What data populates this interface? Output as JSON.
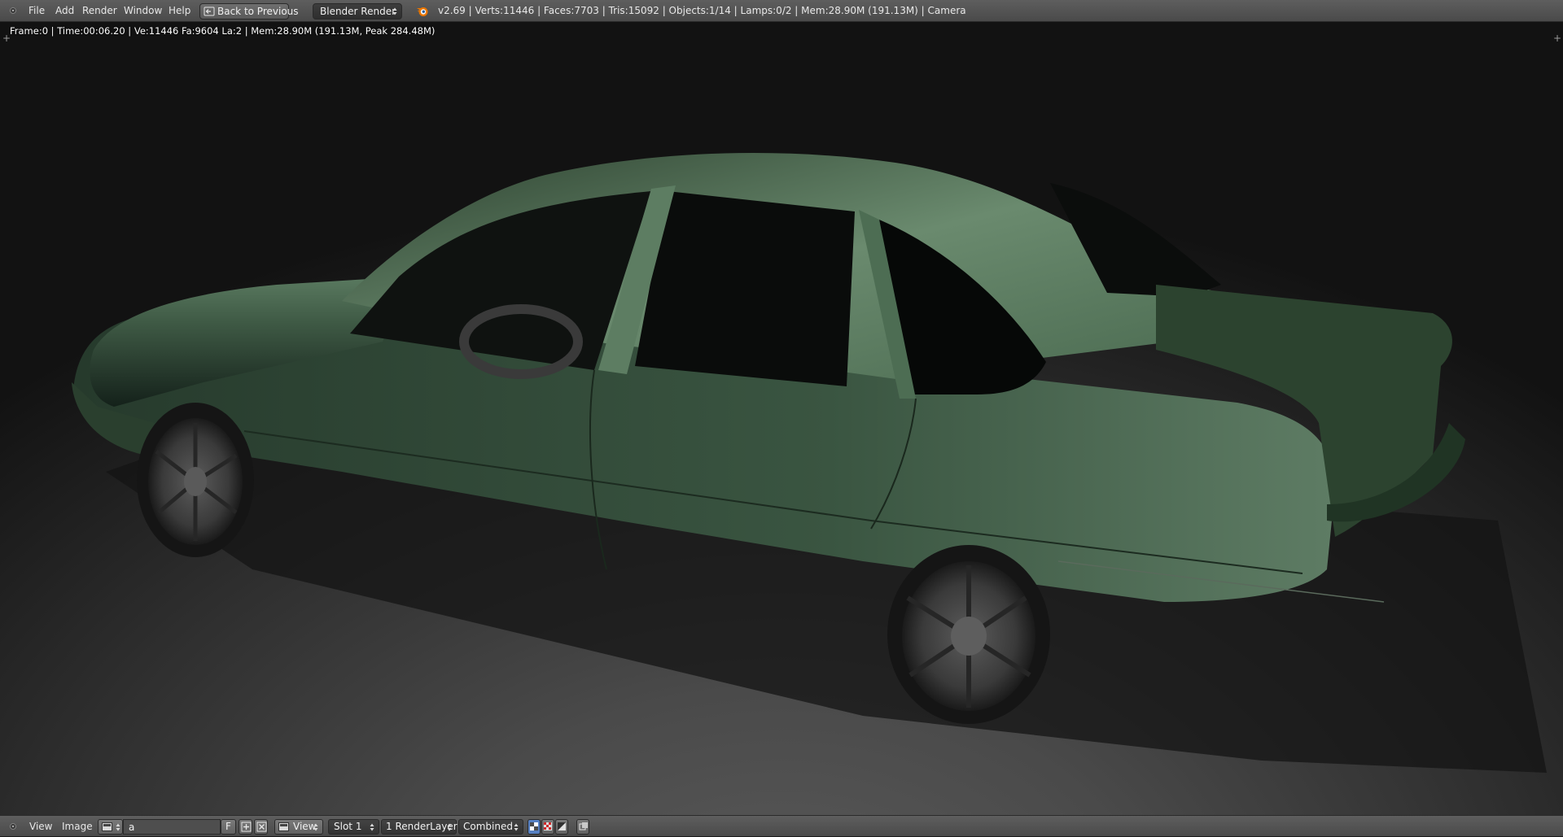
{
  "top_bar": {
    "menus": [
      {
        "label": "File"
      },
      {
        "label": "Add"
      },
      {
        "label": "Render"
      },
      {
        "label": "Window"
      },
      {
        "label": "Help"
      }
    ],
    "back_button_label": "Back to Previous",
    "engine_select": "Blender Render",
    "stats": "v2.69 | Verts:11446 | Faces:7703 | Tris:15092 | Objects:1/14 | Lamps:0/2 | Mem:28.90M (191.13M) | Camera",
    "icons": {
      "editor_type": "triangle-down-icon",
      "back": "back-arrow-icon",
      "engine": "blender-logo-icon"
    }
  },
  "viewport": {
    "render_info": "Frame:0 | Time:00:06.20 | Ve:11446 Fa:9604 La:2 | Mem:28.90M (191.13M, Peak 284.48M)",
    "car_color": "#4c6a52",
    "floor_color": "#4a4a4a"
  },
  "bottom_bar": {
    "menus": [
      {
        "label": "View"
      },
      {
        "label": "Image"
      }
    ],
    "image_name": "a",
    "fake_user_label": "F",
    "view_label": "View",
    "slot_label": "Slot 1",
    "render_layer_label": "1 RenderLayer",
    "pass_label": "Combined",
    "icons": {
      "editor_type": "image-editor-icon",
      "new": "plus-icon",
      "unlink": "x-icon",
      "mode": "view-mode-icon"
    }
  }
}
